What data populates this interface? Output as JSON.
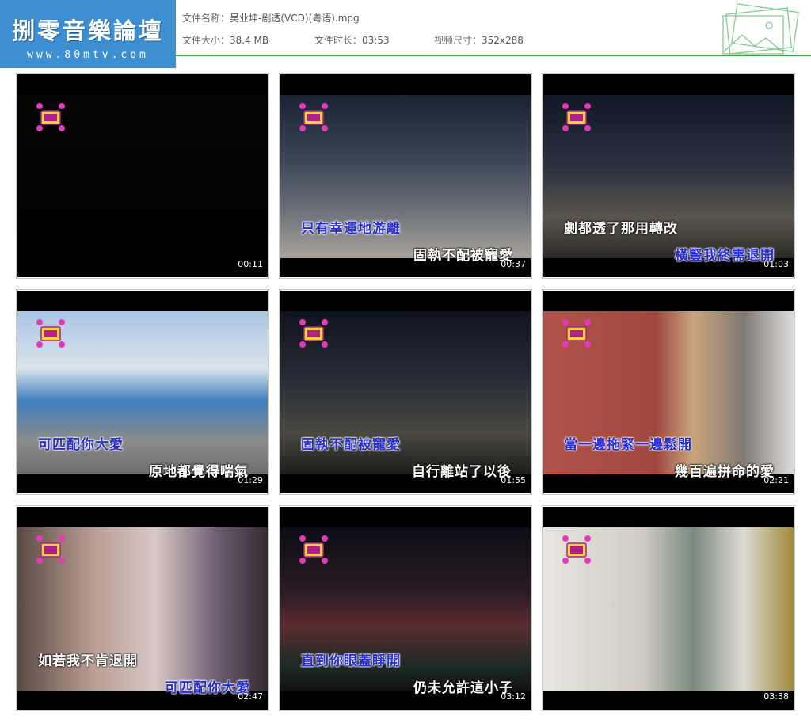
{
  "logo": {
    "title": "捌零音樂論壇",
    "url": "www.80mtv.com"
  },
  "file": {
    "name_label": "文件名称：",
    "name_value": "吴业坤-剧透(VCD)(粤语).mpg",
    "size_label": "文件大小：",
    "size_value": "38.4 MB",
    "duration_label": "文件时长：",
    "duration_value": "03:53",
    "dims_label": "视频尺寸：",
    "dims_value": "352x288"
  },
  "colors": {
    "logo_bg": "#3d8fd1",
    "divider": "#3aa33f",
    "lyric_blue": "#2a2fd0"
  },
  "thumbnails": [
    {
      "time": "00:11",
      "lyric_top": "",
      "lyric_bottom": "",
      "icon": "emblem-icon"
    },
    {
      "time": "00:37",
      "lyric_top": "只有幸運地游離",
      "lyric_bottom": "固執不配被寵愛",
      "icon": "emblem-icon"
    },
    {
      "time": "01:03",
      "lyric_top": "劇都透了那用轉改",
      "lyric_bottom": "橫豎我終需退開",
      "icon": "emblem-icon"
    },
    {
      "time": "01:29",
      "lyric_top": "可匹配你大愛",
      "lyric_bottom": "原地都覺得喘氣",
      "icon": "emblem-icon"
    },
    {
      "time": "01:55",
      "lyric_top": "固執不配被寵愛",
      "lyric_bottom": "自行離站了以後",
      "icon": "emblem-icon"
    },
    {
      "time": "02:21",
      "lyric_top": "當一邊拖緊一邊鬆開",
      "lyric_bottom": "幾百遍拼命的愛",
      "icon": "emblem-icon"
    },
    {
      "time": "02:47",
      "lyric_top": "如若我不肯退開",
      "lyric_bottom": "可匹配你大愛",
      "icon": "emblem-icon"
    },
    {
      "time": "03:12",
      "lyric_top": "直到你眼蓋睜開",
      "lyric_bottom": "仍未允許這小子",
      "icon": "emblem-icon"
    },
    {
      "time": "03:38",
      "lyric_top": "",
      "lyric_bottom": "",
      "icon": "emblem-icon"
    }
  ]
}
